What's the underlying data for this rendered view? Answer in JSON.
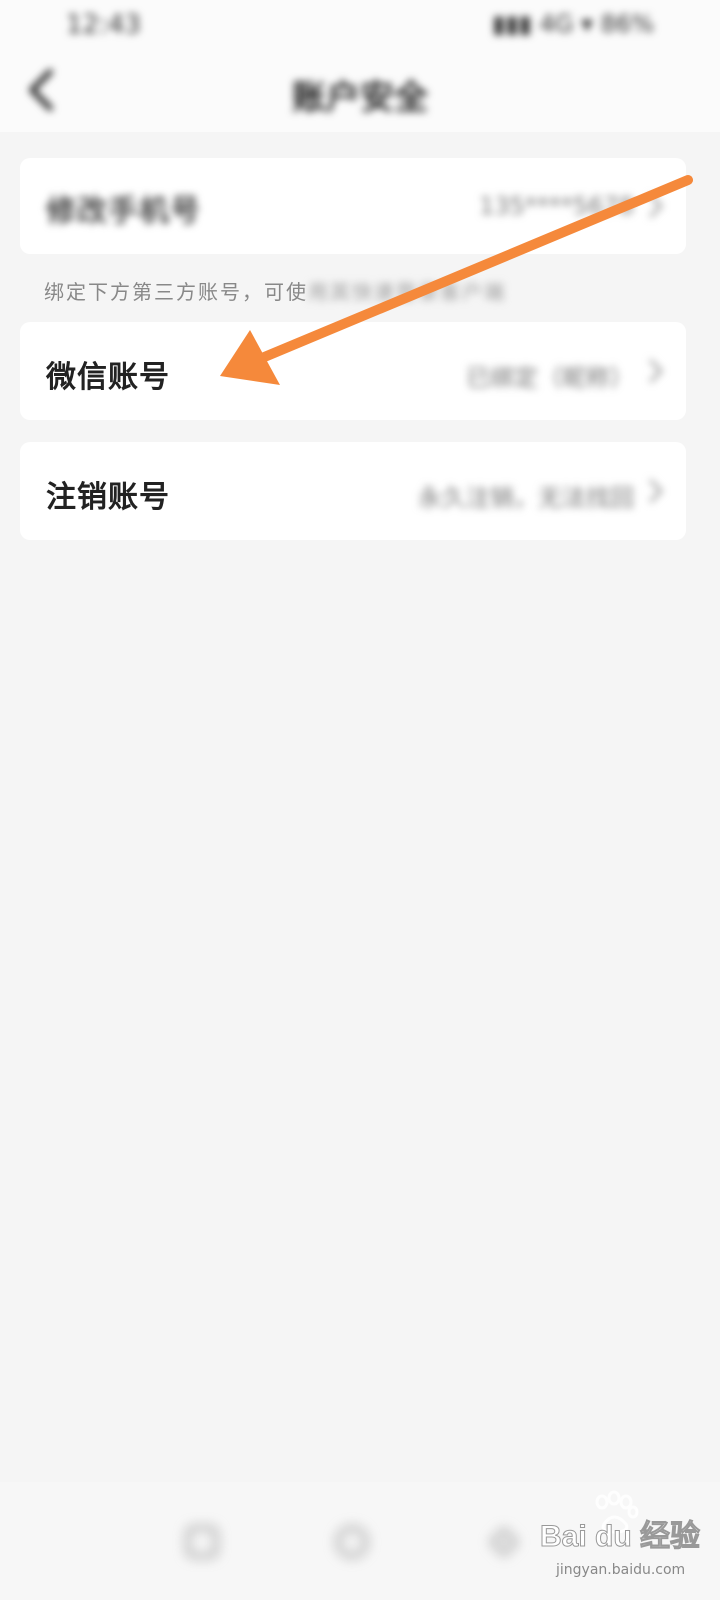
{
  "status_bar": {
    "time": "12:43",
    "indicators": "▮▮▮ 4G ▾ 86%"
  },
  "header": {
    "title": "账户安全"
  },
  "rows": {
    "change_phone": {
      "label": "修改手机号",
      "value": "135****5678"
    },
    "wechat": {
      "label": "微信账号",
      "value": "已绑定（昵称）"
    },
    "deactivate": {
      "label": "注销账号",
      "value": "永久注销，无法找回"
    }
  },
  "hint": {
    "visible": "绑定下方第三方账号，可使",
    "blurred": "用其快速登录客户端"
  },
  "watermark": {
    "brand": "Bai du 经验",
    "url": "jingyan.baidu.com"
  },
  "colors": {
    "background": "#f5f5f5",
    "card": "#ffffff",
    "annotation_arrow": "#f5893b"
  },
  "icons": {
    "back": "chevron-left-icon",
    "row_arrow": "chevron-right-icon",
    "nav": [
      "home-icon",
      "discover-icon",
      "profile-icon"
    ]
  }
}
